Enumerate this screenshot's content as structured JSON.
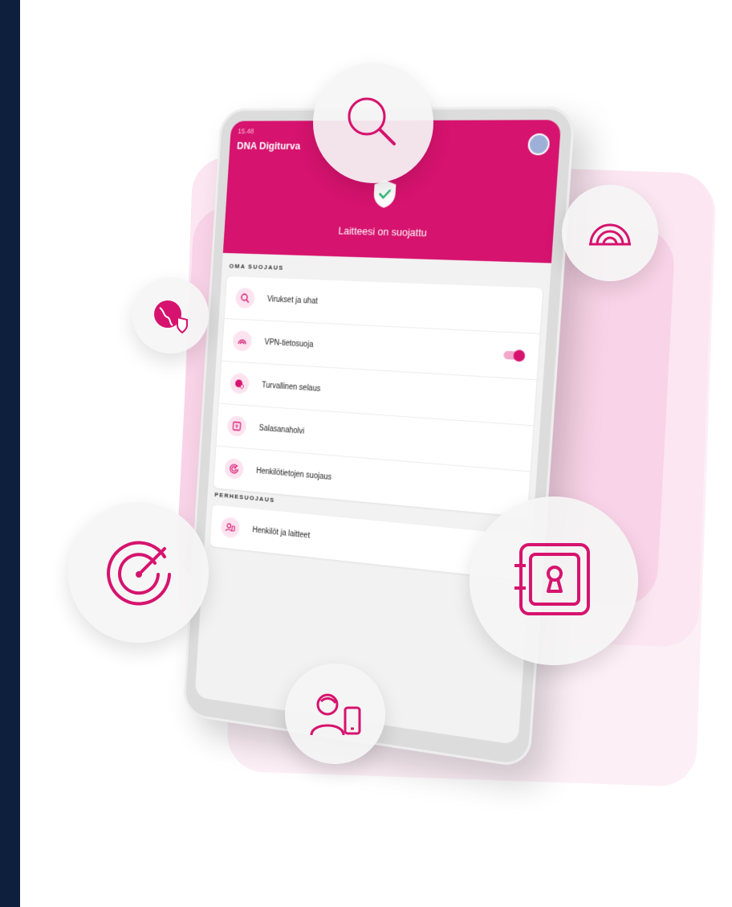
{
  "app": {
    "status_time": "15.48",
    "title": "DNA Digiturva",
    "protected_text": "Laitteesi on suojattu"
  },
  "sections": {
    "own": {
      "label": "OMA SUOJAUS",
      "items": [
        {
          "label": "Virukset ja uhat",
          "icon": "search-icon"
        },
        {
          "label": "VPN-tietosuoja",
          "icon": "wifi-signal-icon",
          "toggle": true
        },
        {
          "label": "Turvallinen selaus",
          "icon": "globe-shield-icon"
        },
        {
          "label": "Salasanaholvi",
          "icon": "vault-icon"
        },
        {
          "label": "Henkilötietojen suojaus",
          "icon": "target-icon"
        }
      ]
    },
    "family": {
      "label": "PERHESUOJAUS",
      "items": [
        {
          "label": "Henkilöt ja laitteet",
          "icon": "person-device-icon"
        }
      ]
    }
  },
  "colors": {
    "brand": "#d6136e",
    "background": "#0d1f3c",
    "pink_light": "#fce3ef"
  }
}
